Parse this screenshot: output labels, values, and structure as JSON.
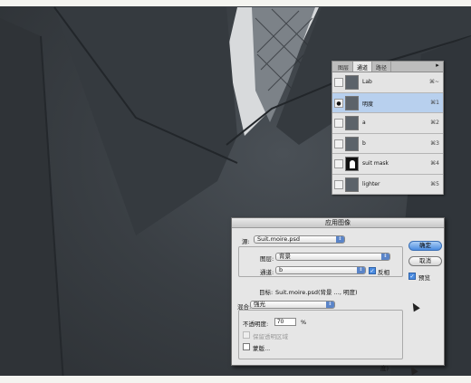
{
  "channels_panel": {
    "tabs": [
      "图层",
      "通道",
      "路径"
    ],
    "active_tab_index": 1,
    "menu_icon": "menu-triangle-icon",
    "rows": [
      {
        "name": "Lab",
        "shortcut": "⌘~",
        "visible": false,
        "selected": false,
        "thumb": "photo"
      },
      {
        "name": "明度",
        "shortcut": "⌘1",
        "visible": true,
        "selected": true,
        "thumb": "photo"
      },
      {
        "name": "a",
        "shortcut": "⌘2",
        "visible": false,
        "selected": false,
        "thumb": "gray"
      },
      {
        "name": "b",
        "shortcut": "⌘3",
        "visible": false,
        "selected": false,
        "thumb": "gray"
      },
      {
        "name": "suit mask",
        "shortcut": "⌘4",
        "visible": false,
        "selected": false,
        "thumb": "mask"
      },
      {
        "name": "lighter",
        "shortcut": "⌘5",
        "visible": false,
        "selected": false,
        "thumb": "photo"
      }
    ]
  },
  "apply_image_dialog": {
    "title": "应用图像",
    "source_label": "源:",
    "source_value": "Suit.moire.psd",
    "layer_label": "图层:",
    "layer_value": "背景",
    "channel_label": "通道:",
    "channel_value": "b",
    "invert_label": "反相",
    "invert_checked": true,
    "target_label": "目标:",
    "target_value": "Suit.moire.psd(背景 ..., 明度)",
    "blending_label": "混合:",
    "blending_value": "强光",
    "opacity_label": "不透明度:",
    "opacity_value": "70",
    "opacity_unit": "%",
    "preserve_transparency_label": "保留透明区域",
    "mask_label": "蒙版...",
    "ok_label": "确定",
    "cancel_label": "取消",
    "preview_label": "预览",
    "preview_checked": true,
    "bottom_fragment": "度)"
  },
  "colors": {
    "selection_blue": "#b8d0ee",
    "default_button_blue": "#4a8be0",
    "suit_gray": "#3e4348"
  }
}
